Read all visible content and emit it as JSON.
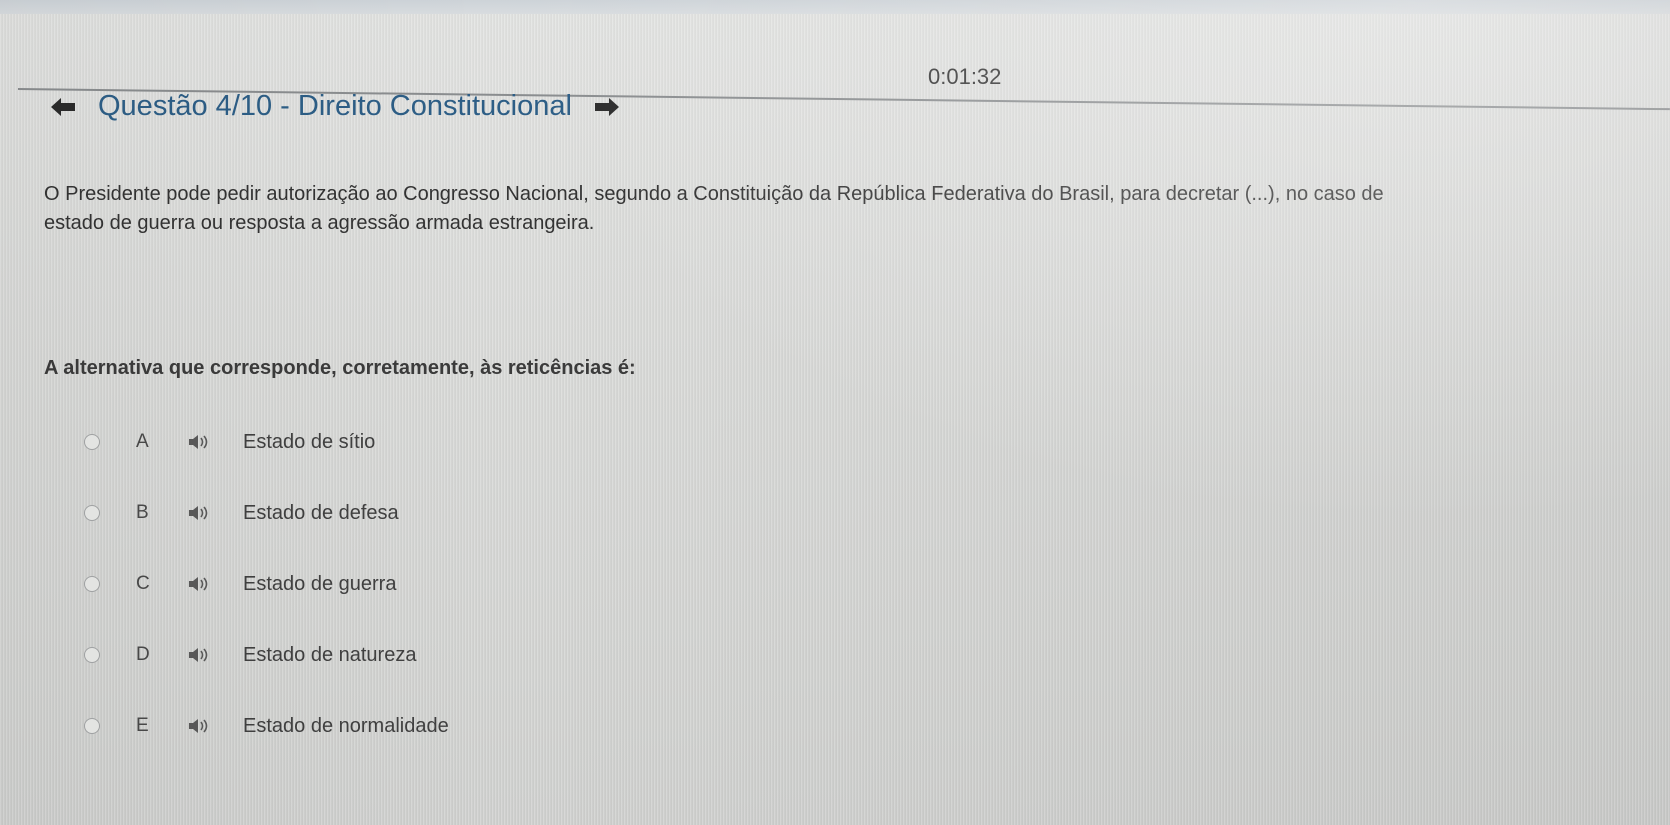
{
  "timer": "0:01:32",
  "header": {
    "prev_icon": "arrow-left-icon",
    "title": "Questão 4/10 - Direito Constitucional",
    "next_icon": "arrow-right-icon"
  },
  "question": {
    "line1": "O Presidente pode pedir autorização ao Congresso Nacional, segundo a Constituição da República Federativa do Brasil, para decretar (...), no caso de",
    "line2": "estado de guerra ou resposta a agressão armada estrangeira."
  },
  "prompt": "A alternativa que corresponde, corretamente, às reticências é:",
  "options": [
    {
      "letter": "A",
      "text": "Estado de sítio",
      "icon": "speaker-icon"
    },
    {
      "letter": "B",
      "text": "Estado de defesa",
      "icon": "speaker-icon"
    },
    {
      "letter": "C",
      "text": "Estado de guerra",
      "icon": "speaker-icon"
    },
    {
      "letter": "D",
      "text": "Estado de natureza",
      "icon": "speaker-icon"
    },
    {
      "letter": "E",
      "text": "Estado de normalidade",
      "icon": "speaker-icon"
    }
  ],
  "colors": {
    "title": "#2d5e86",
    "background": "#dcdddb",
    "text": "#333333"
  }
}
